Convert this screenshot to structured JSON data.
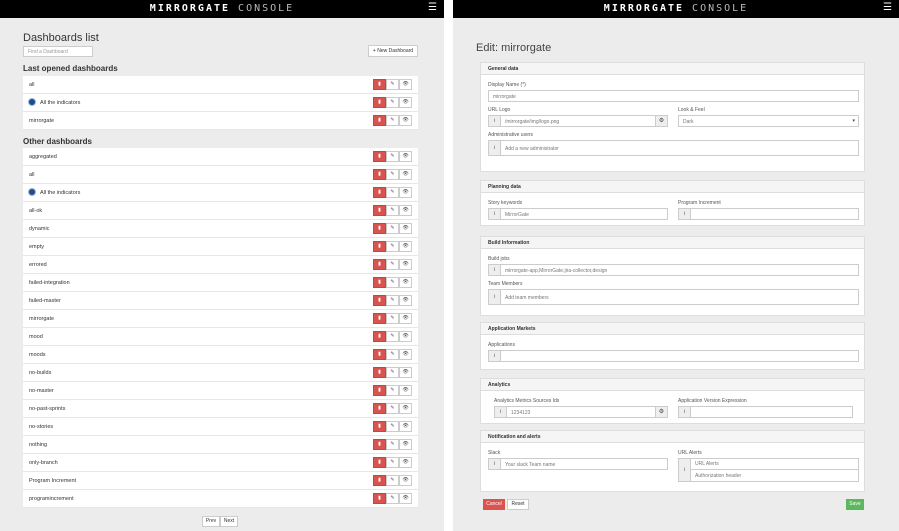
{
  "brand": {
    "name": "MIRRORGATE",
    "suffix": "CONSOLE"
  },
  "left": {
    "title": "Dashboards list",
    "find_placeholder": "Find a Dashboard",
    "new_button": "+ New Dashboard",
    "last_opened_title": "Last opened dashboards",
    "last_opened": [
      {
        "name": "all",
        "avatar": false
      },
      {
        "name": "All the indicators",
        "avatar": true
      },
      {
        "name": "mirrorgate",
        "avatar": false
      }
    ],
    "other_title": "Other dashboards",
    "other": [
      {
        "name": "aggregated",
        "avatar": false
      },
      {
        "name": "all",
        "avatar": false
      },
      {
        "name": "All the indicators",
        "avatar": true
      },
      {
        "name": "all-ok",
        "avatar": false
      },
      {
        "name": "dynamic",
        "avatar": false
      },
      {
        "name": "empty",
        "avatar": false
      },
      {
        "name": "errored",
        "avatar": false
      },
      {
        "name": "failed-integration",
        "avatar": false
      },
      {
        "name": "failed-master",
        "avatar": false
      },
      {
        "name": "mirrorgate",
        "avatar": false
      },
      {
        "name": "mood",
        "avatar": false
      },
      {
        "name": "moods",
        "avatar": false
      },
      {
        "name": "no-builds",
        "avatar": false
      },
      {
        "name": "no-master",
        "avatar": false
      },
      {
        "name": "no-past-sprints",
        "avatar": false
      },
      {
        "name": "no-stories",
        "avatar": false
      },
      {
        "name": "nothing",
        "avatar": false
      },
      {
        "name": "only-branch",
        "avatar": false
      },
      {
        "name": "Program Increment",
        "avatar": false
      },
      {
        "name": "programincrement",
        "avatar": false
      }
    ],
    "prev": "Prev",
    "next": "Next"
  },
  "right": {
    "title": "Edit: mirrorgate",
    "general": {
      "header": "General data",
      "display_name_label": "Display Name (*)",
      "display_name_value": "mirrorgate",
      "url_logo_label": "URL Logo",
      "url_logo_value": "/mirrorgate/img/logo.png",
      "look_label": "Look & Feel",
      "look_value": "Dark",
      "admin_label": "Administrative users",
      "admin_placeholder": "Add a new administrator"
    },
    "planning": {
      "header": "Planning data",
      "story_label": "Story keywords",
      "story_value": "MirrorGate",
      "pi_label": "Program Increment",
      "pi_value": ""
    },
    "build": {
      "header": "Build Information",
      "jobs_label": "Build jobs",
      "jobs_value": "mirrorgate-app,MirrorGate.jira-collector,design",
      "team_label": "Team Members",
      "team_placeholder": "Add team members"
    },
    "markets": {
      "header": "Application Markets",
      "apps_label": "Applications",
      "apps_value": ""
    },
    "analytics": {
      "header": "Analytics",
      "sources_label": "Analytics Metrics Sources Ids",
      "sources_value": "1234123",
      "version_label": "Application Version Expression",
      "version_value": ""
    },
    "notify": {
      "header": "Notification and alerts",
      "slack_label": "Slack",
      "slack_placeholder": "Your slack Team name",
      "url_alerts_label": "URL Alerts",
      "url_alerts_placeholder": "URL Alerts",
      "auth_placeholder": "Authorization header"
    },
    "cancel": "Cancel",
    "reset": "Reset",
    "save": "Save"
  }
}
